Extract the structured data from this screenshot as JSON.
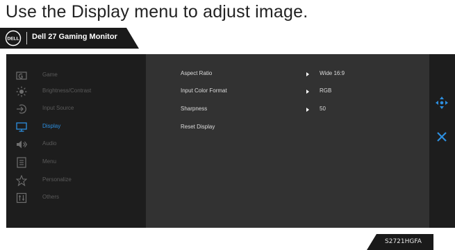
{
  "instruction": "Use the Display menu to adjust image.",
  "header": {
    "logo_text": "DØLL",
    "title": "Dell 27 Gaming Monitor"
  },
  "menu": {
    "items": [
      {
        "label": "Game",
        "icon": "game-icon",
        "active": false
      },
      {
        "label": "Brightness/Contrast",
        "icon": "brightness-icon",
        "active": false
      },
      {
        "label": "Input Source",
        "icon": "input-source-icon",
        "active": false
      },
      {
        "label": "Display",
        "icon": "display-icon",
        "active": true
      },
      {
        "label": "Audio",
        "icon": "audio-icon",
        "active": false
      },
      {
        "label": "Menu",
        "icon": "menu-icon",
        "active": false
      },
      {
        "label": "Personalize",
        "icon": "star-icon",
        "active": false
      },
      {
        "label": "Others",
        "icon": "others-icon",
        "active": false
      }
    ]
  },
  "display_submenu": {
    "rows": [
      {
        "label": "Aspect Ratio",
        "value": "Wide 16:9"
      },
      {
        "label": "Input Color Format",
        "value": "RGB"
      },
      {
        "label": "Sharpness",
        "value": "50"
      },
      {
        "label": "Reset Display",
        "value": ""
      }
    ]
  },
  "nav": {
    "move_icon": "move-icon",
    "close_icon": "close-icon"
  },
  "model": "S2721HGFA",
  "colors": {
    "active_accent": "#2d8fe0",
    "osd_background": "#1d1d1d",
    "panel_background": "#323232"
  }
}
